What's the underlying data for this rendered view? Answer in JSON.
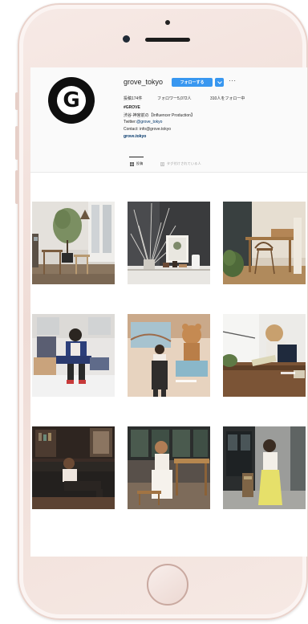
{
  "device": {
    "frame_color": "#f2e1dc",
    "accent": "#3897f0"
  },
  "profile": {
    "avatar_letter": "G",
    "username": "grove_tokyo",
    "follow_label": "フォローする",
    "dropdown_icon": "chevron-down-icon",
    "more_label": "···",
    "stats": {
      "posts": "投稿174件",
      "followers": "フォロワー5,072人",
      "following": "310人をフォロー中"
    },
    "bio": {
      "name": "#GROVE",
      "line1": "渋谷·神宮前の【Influencer Production】",
      "twitter": "Twitter:@grove_tokyo",
      "contact": "Contact: info@grove.tokyo",
      "url": "grove.tokyo"
    }
  },
  "tabs": {
    "posts": "投稿",
    "tagged": "タグ付けされている人"
  },
  "grid": [
    {
      "scene": "living-room-with-olive-tree"
    },
    {
      "scene": "branch-vase-display-table"
    },
    {
      "scene": "wooden-desk-and-chair"
    },
    {
      "scene": "man-seated-on-floor"
    },
    {
      "scene": "woman-in-overalls-with-bear-painting"
    },
    {
      "scene": "woman-reading-by-window"
    },
    {
      "scene": "woman-on-leather-sofa"
    },
    {
      "scene": "woman-at-cafe-table"
    },
    {
      "scene": "woman-in-yellow-skirt-outdoors"
    }
  ]
}
